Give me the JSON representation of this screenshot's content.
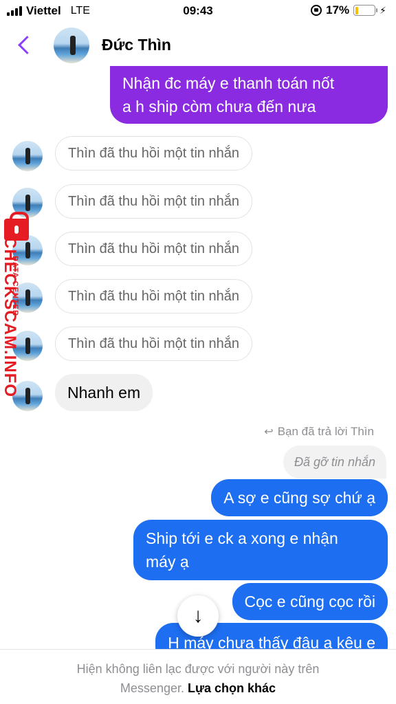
{
  "status_bar": {
    "carrier": "Viettel",
    "network": "LTE",
    "time": "09:43",
    "battery_percent": "17%",
    "battery_level": 0.17
  },
  "header": {
    "contact_name": "Đức Thìn",
    "accent_color": "#8a3ffc"
  },
  "messages": [
    {
      "side": "out",
      "color": "purple",
      "text": "Nhận đc máy e thanh toán nốt\na h ship còm chưa đến nưa"
    },
    {
      "side": "in",
      "type": "unsent",
      "text": "Thìn đã thu hồi một tin nhắn"
    },
    {
      "side": "in",
      "type": "unsent",
      "text": "Thìn đã thu hồi một tin nhắn"
    },
    {
      "side": "in",
      "type": "unsent",
      "text": "Thìn đã thu hồi một tin nhắn"
    },
    {
      "side": "in",
      "type": "unsent",
      "text": "Thìn đã thu hồi một tin nhắn"
    },
    {
      "side": "in",
      "type": "unsent",
      "text": "Thìn đã thu hồi một tin nhắn"
    },
    {
      "side": "in",
      "type": "text",
      "text": "Nhanh em"
    },
    {
      "side": "out",
      "color": "blue",
      "text": "A sợ e cũng sợ chứ ạ"
    },
    {
      "side": "out",
      "color": "blue",
      "text": "Ship tới e ck a xong e nhận\nmáy ạ"
    },
    {
      "side": "out",
      "color": "blue",
      "text": "Cọc e cũng cọc rồi"
    },
    {
      "side": "out",
      "color": "blue",
      "text": "H máy chưa thấy đâu a kêu e"
    }
  ],
  "reply_note": "Bạn đã trả lời Thìn",
  "removed_message": "Đã gỡ tin nhắn",
  "footer": {
    "notice": "Hiện không liên lạc được với người này trên",
    "notice_end": "Messenger.",
    "link": "Lựa chọn khác"
  },
  "watermark": {
    "main": "CHECKSCAM.INFO",
    "sub": "DATA CENTER"
  },
  "colors": {
    "purple_bubble": "#8a2be2",
    "blue_bubble": "#1d6ef0",
    "watermark_red": "#e51c23"
  }
}
